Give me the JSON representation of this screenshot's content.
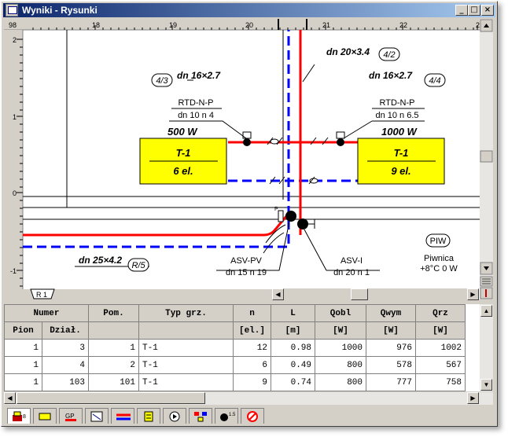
{
  "window": {
    "title": "Wyniki - Rysunki"
  },
  "ruler": {
    "top": [
      "98",
      "18",
      "19",
      "20",
      "21",
      "22",
      "23"
    ],
    "left": [
      "2",
      "1",
      "0",
      "-1"
    ]
  },
  "drawing": {
    "labels": {
      "pipe_top": "dn 20×3.4",
      "pipe_top_id": "4/2",
      "left_pipe": "dn 16×2.7",
      "left_pipe_id": "4/3",
      "right_pipe": "dn 16×2.7",
      "right_pipe_id": "4/4",
      "left_valve_type": "RTD-N-P",
      "left_valve_spec": "dn 10  n 4",
      "right_valve_type": "RTD-N-P",
      "right_valve_spec": "dn 10  n 6.5",
      "left_power": "500 W",
      "right_power": "1000 W",
      "left_rad_type": "T-1",
      "left_rad_el": "6 el.",
      "right_rad_type": "T-1",
      "right_rad_el": "9 el.",
      "bottom_pipe": "dn 25×4.2",
      "bottom_pipe_id": "R/5",
      "asvpv": "ASV-PV",
      "asvpv_spec": "dn 15  n 19",
      "asvi": "ASV-I",
      "asvi_spec": "dn 20  n 1",
      "room_code": "PIW",
      "room_name": "Piwnica",
      "room_temp": "+8°C 0 W",
      "small_p": "P"
    },
    "tab": "R 1"
  },
  "table": {
    "header1": [
      "Numer",
      "Pom.",
      "Typ grz.",
      "n",
      "L",
      "Qobl",
      "Qwym",
      "Qrz"
    ],
    "header2": [
      "Pion",
      "Dział.",
      "",
      "",
      "[el.]",
      "[m]",
      "[W]",
      "[W]",
      "[W]"
    ],
    "rows": [
      [
        "1",
        "3",
        "1",
        "T-1",
        "12",
        "0.98",
        "1000",
        "976",
        "1002"
      ],
      [
        "1",
        "4",
        "2",
        "T-1",
        "6",
        "0.49",
        "800",
        "578",
        "567"
      ],
      [
        "1",
        "103",
        "101",
        "T-1",
        "9",
        "0.74",
        "800",
        "777",
        "758"
      ]
    ]
  },
  "bottom_tabs": [
    {
      "icon": "radiator-pion-icon",
      "label": "8"
    },
    {
      "icon": "radiator-icon",
      "label": ""
    },
    {
      "icon": "gp-icon",
      "label": "GP"
    },
    {
      "icon": "view-icon",
      "label": ""
    },
    {
      "icon": "pipes-icon",
      "label": ""
    },
    {
      "icon": "panel-icon",
      "label": ""
    },
    {
      "icon": "play-icon",
      "label": ""
    },
    {
      "icon": "network-icon",
      "label": ""
    },
    {
      "icon": "node-icon",
      "label": "1.5"
    },
    {
      "icon": "no-entry-icon",
      "label": ""
    }
  ],
  "colors": {
    "supply": "#ff0000",
    "return": "#0000ff",
    "radiator": "#ffff00",
    "title_start": "#0a246a",
    "title_end": "#a6caf0"
  }
}
